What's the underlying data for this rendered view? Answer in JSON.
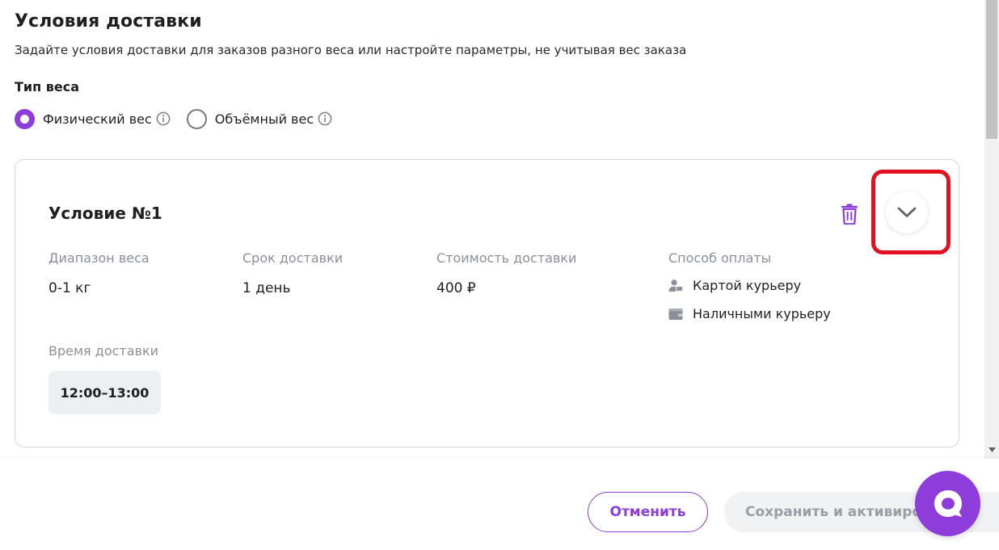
{
  "header": {
    "title": "Условия доставки",
    "subtitle": "Задайте условия доставки для заказов разного веса или настройте параметры, не учитывая вес заказа"
  },
  "weight_type": {
    "label": "Тип веса",
    "options": [
      {
        "label": "Физический вес",
        "selected": true
      },
      {
        "label": "Объёмный вес",
        "selected": false
      }
    ]
  },
  "condition": {
    "title": "Условие №1",
    "weight_range": {
      "label": "Диапазон веса",
      "value": "0-1 кг"
    },
    "delivery_term": {
      "label": "Срок доставки",
      "value": "1 день"
    },
    "delivery_cost": {
      "label": "Стоимость доставки",
      "value": "400 ₽"
    },
    "payment": {
      "label": "Способ оплаты",
      "methods": [
        {
          "label": "Картой курьеру",
          "icon": "card-courier-icon"
        },
        {
          "label": "Наличными курьеру",
          "icon": "wallet-icon"
        }
      ]
    },
    "delivery_time": {
      "label": "Время доставки",
      "slot": "12:00–13:00"
    }
  },
  "footer": {
    "cancel_label": "Отменить",
    "save_label": "Сохранить и активиро"
  },
  "colors": {
    "accent": "#8e3ddb",
    "highlight": "#e3101f",
    "muted_text": "#8a8f98",
    "chip_bg": "#edf0f2"
  }
}
